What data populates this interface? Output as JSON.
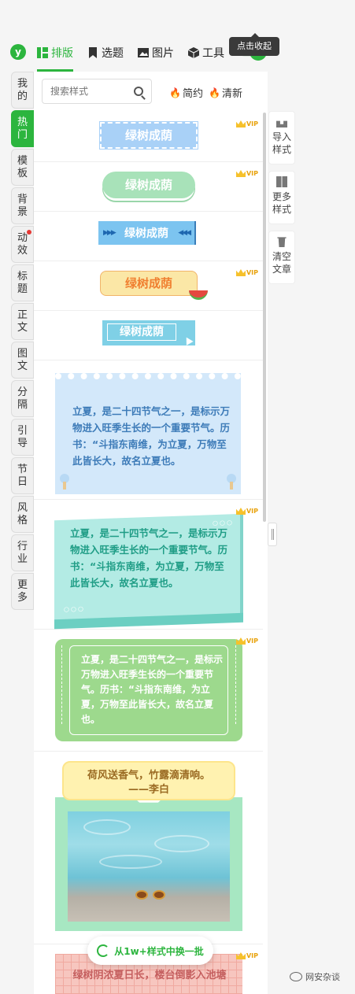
{
  "nav": {
    "logo_letter": "y",
    "tabs": [
      {
        "label": "排版",
        "icon": "layout-icon",
        "active": true
      },
      {
        "label": "选题",
        "icon": "bookmark-icon",
        "active": false
      },
      {
        "label": "图片",
        "icon": "image-icon",
        "active": false
      },
      {
        "label": "工具",
        "icon": "cube-icon",
        "active": false
      }
    ],
    "toggle_tooltip": "点击收起"
  },
  "left_tabs": [
    "我的",
    "热门",
    "模板",
    "背景",
    "动效",
    "标题",
    "正文",
    "图文",
    "分隔",
    "引导",
    "节日",
    "风格",
    "行业",
    "更多"
  ],
  "search": {
    "placeholder": "搜索样式",
    "filters": [
      "简约",
      "清新"
    ]
  },
  "styles": {
    "title_text": "绿树成荫",
    "vip_label": "VIP",
    "paragraph": "立夏，是二十四节气之一，是标示万物进入旺季生长的一个重要节气。历书：“斗指东南维，为立夏，万物至此皆长大，故名立夏也。",
    "poem_line1": "荷风送香气，竹露滴清响。",
    "poem_line2": "——李白",
    "last_text": "绿树阴浓夏日长，楼台倒影入池塘"
  },
  "change_button": "从1w+样式中换一批",
  "right_tools": [
    {
      "label": "导入样式",
      "icon": "import-icon"
    },
    {
      "label": "更多样式",
      "icon": "grid-icon"
    },
    {
      "label": "清空文章",
      "icon": "trash-icon"
    }
  ],
  "watermark": "网安杂谈",
  "colors": {
    "accent": "#2cb53e",
    "tooltip_bg": "#3a3a3a",
    "vip": "#f6c12b"
  }
}
